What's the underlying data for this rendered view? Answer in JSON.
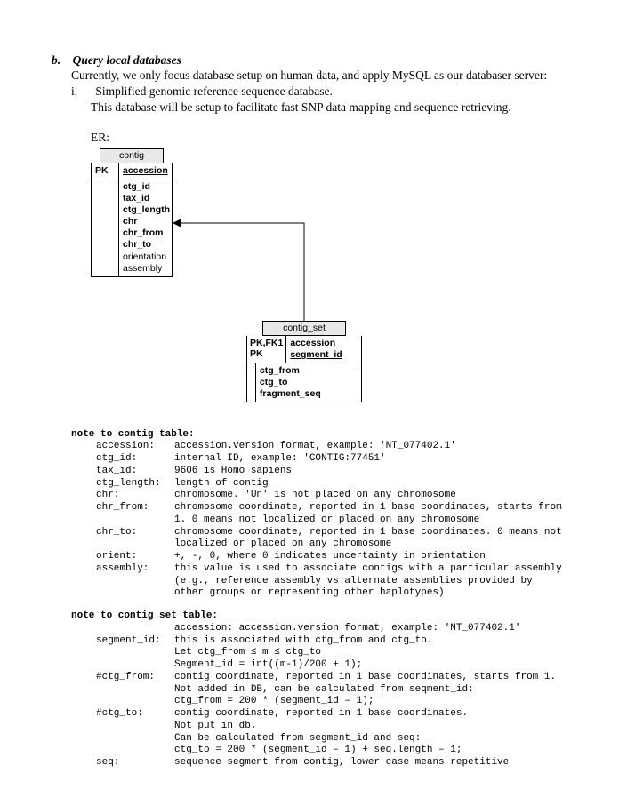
{
  "section": {
    "label": "b.",
    "title": "Query local databases",
    "intro1": "Currently, we only focus database setup on human data, and apply MySQL as our databaser server:",
    "sub_label": "i.",
    "sub_title": "Simplified genomic reference sequence database.",
    "sub_body1": "This database will be setup to facilitate fast SNP data mapping and sequence retrieving.",
    "er_label": "ER:"
  },
  "entity_contig": {
    "title": "contig",
    "pk_label": "PK",
    "pk_field": "accession",
    "f1": "ctg_id",
    "f2": "tax_id",
    "f3": "ctg_length",
    "f4": "chr",
    "f5": "chr_from",
    "f6": "chr_to",
    "f7": "orientation",
    "f8": "assembly"
  },
  "entity_contig_set": {
    "title": "contig_set",
    "pk_label": "PK,FK1\nPK",
    "pk_field1": "accession",
    "pk_field2": "segment_id",
    "f1": "ctg_from",
    "f2": "ctg_to",
    "f3": "fragment_seq"
  },
  "notes1": {
    "title": "note to contig table:",
    "rows": [
      {
        "k": "accession:",
        "v": "accession.version format, example: 'NT_077402.1'"
      },
      {
        "k": "ctg_id:",
        "v": "internal ID, example: 'CONTIG:77451'"
      },
      {
        "k": "tax_id:",
        "v": "9606 is Homo sapiens"
      },
      {
        "k": "ctg_length:",
        "v": "length of contig"
      },
      {
        "k": "chr:",
        "v": "chromosome. 'Un' is not placed on any chromosome"
      },
      {
        "k": "chr_from:",
        "v": "chromosome coordinate, reported in 1 base coordinates, starts from 1. 0 means not localized or placed on any chromosome"
      },
      {
        "k": "chr_to:",
        "v": "chromosome coordinate, reported in 1 base coordinates. 0 means not localized or placed on any chromosome"
      },
      {
        "k": "orient:",
        "v": "+, -, 0, where 0 indicates uncertainty in orientation"
      },
      {
        "k": "assembly:",
        "v": "this value is used to associate contigs with a particular assembly (e.g., reference assembly vs alternate assemblies provided by other groups or representing other haplotypes)"
      }
    ]
  },
  "notes2": {
    "title": "note to contig_set table:",
    "lead": {
      "k": "",
      "v": "accession:   accession.version format, example: 'NT_077402.1'"
    },
    "rows": [
      {
        "k": "segment_id:",
        "v": "this is associated with ctg_from and ctg_to.",
        "cont": [
          "Let ctg_from ≤ m ≤ ctg_to",
          "Segment_id = int((m-1)/200 + 1);"
        ]
      },
      {
        "k": "#ctg_from:",
        "v": "contig coordinate, reported in 1 base coordinates, starts from 1. Not added in DB, can be calculated from seqment_id:",
        "cont": [
          "ctg_from = 200 * (segment_id – 1);"
        ]
      },
      {
        "k": "#ctg_to:",
        "v": "contig coordinate, reported in 1 base coordinates.",
        "cont": [
          "Not put in db.",
          "Can be calculated from segment_id and seq:",
          "ctg_to = 200 * (segment_id – 1) + seq.length – 1;"
        ]
      },
      {
        "k": "seq:",
        "v": "sequence segment from contig, lower case means repetitive"
      }
    ]
  }
}
